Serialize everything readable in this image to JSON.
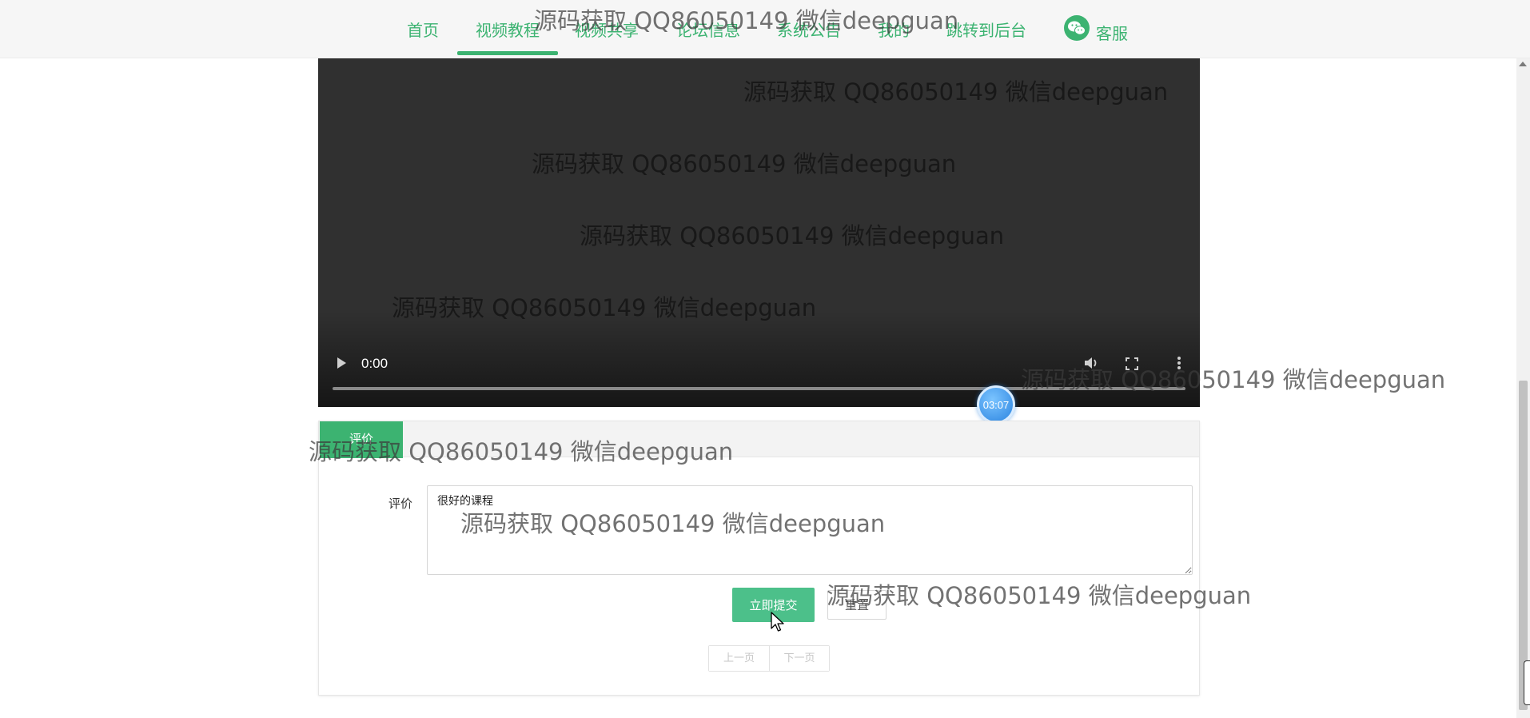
{
  "nav": {
    "items": [
      "首页",
      "视频教程",
      "视频共享",
      "论坛信息",
      "系统公告",
      "我的",
      "跳转到后台",
      "客服"
    ],
    "active": "视频教程"
  },
  "video": {
    "current_time": "0:00",
    "progress": 0
  },
  "timer": "03:07",
  "review": {
    "tab_label": "评价",
    "field_label": "评价",
    "field_value": "很好的课程",
    "submit_label": "立即提交",
    "reset_label": "重置"
  },
  "pager": {
    "prev": "上一页",
    "next": "下一页"
  },
  "watermark": "源码获取 QQ86050149 微信deepguan",
  "colors": {
    "accent": "#3cb371",
    "video_bg": "#303030",
    "timer": "#2b84e0"
  },
  "icons": [
    "wechat-icon",
    "play-icon",
    "volume-icon",
    "fullscreen-icon",
    "more-vertical-icon",
    "cursor-arrow-icon"
  ]
}
